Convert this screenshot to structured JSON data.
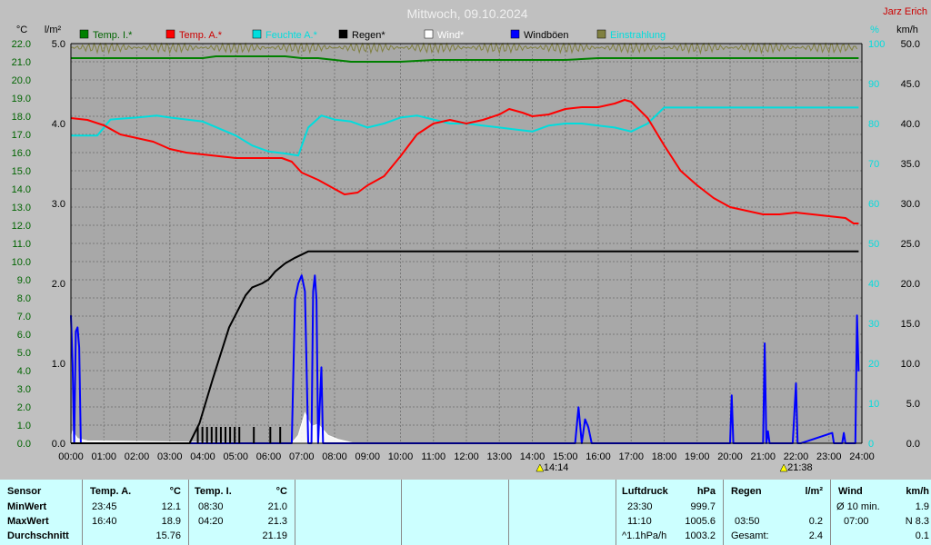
{
  "chart_data": {
    "type": "line",
    "title": "Mittwoch, 09.10.2024",
    "watermark": "Jarz Erich",
    "left_axis_1": {
      "unit": "°C",
      "ylim": [
        0,
        22
      ],
      "ticks": [
        "0.0",
        "1.0",
        "2.0",
        "3.0",
        "4.0",
        "5.0",
        "6.0",
        "7.0",
        "8.0",
        "9.0",
        "10.0",
        "11.0",
        "12.0",
        "13.0",
        "14.0",
        "15.0",
        "16.0",
        "17.0",
        "18.0",
        "19.0",
        "20.0",
        "21.0",
        "22.0"
      ]
    },
    "left_axis_2": {
      "unit": "l/m²",
      "ylim": [
        0,
        5
      ],
      "ticks": [
        "0.0",
        "1.0",
        "2.0",
        "3.0",
        "4.0",
        "5.0"
      ]
    },
    "right_axis_1": {
      "unit": "%",
      "ylim": [
        0,
        100
      ],
      "ticks": [
        "0",
        "10",
        "20",
        "30",
        "40",
        "50",
        "60",
        "70",
        "80",
        "90",
        "100"
      ]
    },
    "right_axis_2": {
      "unit": "km/h",
      "ylim": [
        0,
        50
      ],
      "ticks": [
        "0.0",
        "5.0",
        "10.0",
        "15.0",
        "20.0",
        "25.0",
        "30.0",
        "35.0",
        "40.0",
        "45.0",
        "50.0"
      ]
    },
    "x_ticks": [
      "00:00",
      "01:00",
      "02:00",
      "03:00",
      "04:00",
      "05:00",
      "06:00",
      "07:00",
      "08:00",
      "09:00",
      "10:00",
      "11:00",
      "12:00",
      "13:00",
      "14:00",
      "15:00",
      "16:00",
      "17:00",
      "18:00",
      "19:00",
      "20:00",
      "21:00",
      "22:00",
      "23:00",
      "24:00"
    ],
    "xlim": [
      0,
      24
    ],
    "grid": true,
    "legend": [
      "Temp. I.*",
      "Temp. A.*",
      "Feuchte A.*",
      "Regen*",
      "Wind*",
      "Windböen",
      "Einstrahlung"
    ],
    "markers": [
      {
        "time": 14.23,
        "label": "14:14"
      },
      {
        "time": 21.63,
        "label": "21:38"
      }
    ],
    "series": [
      {
        "name": "Temp. I.*",
        "axis": "left_axis_1",
        "color": "#008000",
        "x": [
          0,
          1,
          2,
          3,
          4,
          4.4,
          5,
          6,
          6.5,
          7,
          7.5,
          8,
          8.5,
          9,
          10,
          11,
          12,
          13,
          14,
          15,
          16,
          17,
          18,
          19,
          20,
          21,
          22,
          23,
          23.9
        ],
        "y": [
          21.2,
          21.2,
          21.2,
          21.2,
          21.2,
          21.3,
          21.3,
          21.3,
          21.3,
          21.2,
          21.2,
          21.1,
          21.0,
          21.0,
          21.0,
          21.1,
          21.1,
          21.1,
          21.1,
          21.1,
          21.2,
          21.2,
          21.2,
          21.2,
          21.2,
          21.2,
          21.2,
          21.2,
          21.2
        ]
      },
      {
        "name": "Temp. A.*",
        "axis": "left_axis_1",
        "color": "#ff0000",
        "x": [
          0,
          0.5,
          1,
          1.5,
          2,
          2.5,
          3,
          3.5,
          4,
          4.5,
          5,
          5.5,
          6,
          6.4,
          6.7,
          7,
          7.5,
          8,
          8.3,
          8.7,
          9,
          9.5,
          10,
          10.5,
          11,
          11.5,
          12,
          12.5,
          13,
          13.3,
          13.7,
          14,
          14.5,
          15,
          15.5,
          16,
          16.5,
          16.8,
          17,
          17.5,
          18,
          18.5,
          19,
          19.5,
          20,
          20.5,
          21,
          21.5,
          22,
          22.5,
          23,
          23.5,
          23.75,
          23.9
        ],
        "y": [
          17.9,
          17.8,
          17.5,
          17.0,
          16.8,
          16.6,
          16.2,
          16.0,
          15.9,
          15.8,
          15.7,
          15.7,
          15.7,
          15.7,
          15.5,
          14.9,
          14.5,
          14.0,
          13.7,
          13.8,
          14.2,
          14.7,
          15.8,
          17.0,
          17.6,
          17.8,
          17.6,
          17.8,
          18.1,
          18.4,
          18.2,
          18.0,
          18.1,
          18.4,
          18.5,
          18.5,
          18.7,
          18.9,
          18.8,
          17.9,
          16.4,
          15.0,
          14.2,
          13.5,
          13.0,
          12.8,
          12.6,
          12.6,
          12.7,
          12.6,
          12.5,
          12.4,
          12.1,
          12.1
        ]
      },
      {
        "name": "Feuchte A.*",
        "axis": "right_axis_1",
        "color": "#00dddd",
        "x": [
          0,
          0.8,
          1.2,
          2,
          2.6,
          3,
          4,
          5,
          5.5,
          6,
          6.5,
          6.9,
          7.2,
          7.6,
          8,
          8.5,
          9,
          9.5,
          10,
          10.5,
          11,
          11.5,
          12,
          12.5,
          13,
          13.5,
          14,
          14.5,
          15,
          15.5,
          16,
          16.5,
          17,
          17.5,
          18,
          19,
          20,
          21,
          22,
          23,
          23.9
        ],
        "y": [
          77,
          77,
          81,
          81.5,
          82,
          81.5,
          80.5,
          77,
          74.5,
          73,
          72.5,
          72,
          79,
          82,
          81,
          80.5,
          79,
          80,
          81.5,
          82,
          81,
          80,
          80,
          79.5,
          79,
          78.5,
          78,
          79.5,
          80,
          80,
          79.5,
          79,
          78,
          80,
          84,
          84,
          84,
          84,
          84,
          84,
          84
        ]
      },
      {
        "name": "Regen*",
        "axis": "left_axis_2",
        "color": "#000000",
        "x": [
          0,
          3.6,
          3.9,
          4.3,
          4.8,
          5.3,
          5.5,
          5.8,
          6.0,
          6.2,
          6.5,
          6.8,
          7.2,
          8,
          9,
          10,
          11,
          12,
          13,
          14,
          15,
          16,
          17,
          18,
          19,
          20,
          21,
          22,
          23,
          23.9
        ],
        "y": [
          0,
          0,
          0.25,
          0.8,
          1.45,
          1.85,
          1.95,
          2.0,
          2.05,
          2.15,
          2.25,
          2.32,
          2.4,
          2.4,
          2.4,
          2.4,
          2.4,
          2.4,
          2.4,
          2.4,
          2.4,
          2.4,
          2.4,
          2.4,
          2.4,
          2.4,
          2.4,
          2.4,
          2.4,
          2.4
        ]
      },
      {
        "name": "Wind*",
        "axis": "right_axis_2",
        "color": "#ffffff",
        "x": [
          0,
          0.05,
          0.2,
          0.5,
          6.7,
          6.9,
          7.1,
          7.3,
          7.5,
          7.8,
          8.1,
          8.4,
          8.6
        ],
        "y": [
          0.5,
          1.5,
          0.6,
          0.3,
          0,
          1.0,
          3.8,
          2.1,
          2.4,
          1.0,
          0.5,
          0.2,
          0
        ],
        "fill": true
      },
      {
        "name": "Windböen",
        "axis": "right_axis_2",
        "color": "#0000ff",
        "x": [
          0,
          0.05,
          0.1,
          0.15,
          0.2,
          0.25,
          0.3,
          0.35,
          0.4,
          0.45,
          0.5,
          6.7,
          6.8,
          6.9,
          7.0,
          7.1,
          7.2,
          7.3,
          7.35,
          7.4,
          7.45,
          7.5,
          7.6,
          7.65,
          7.7,
          7.8,
          7.9,
          15.3,
          15.4,
          15.5,
          15.6,
          15.7,
          15.8,
          15.9,
          20.0,
          20.05,
          20.1,
          21.0,
          21.05,
          21.1,
          21.15,
          21.2,
          21.3,
          21.9,
          22.0,
          22.05,
          22.15,
          23.1,
          23.15,
          23.2,
          23.4,
          23.45,
          23.5,
          23.8,
          23.85,
          23.9
        ],
        "y": [
          16,
          10,
          0,
          14,
          14.5,
          12,
          0,
          0,
          0,
          0,
          0,
          0,
          18,
          20,
          21,
          19,
          0,
          0,
          19,
          21,
          18,
          0,
          9.5,
          0,
          0,
          0,
          0,
          0,
          4.5,
          0,
          3,
          2,
          0,
          0,
          0,
          6,
          0,
          0,
          12.5,
          0,
          1.5,
          0,
          0,
          0,
          7.5,
          0,
          0,
          1.3,
          0,
          0,
          0,
          1.3,
          0,
          0,
          16,
          9
        ]
      },
      {
        "name": "Einstrahlung",
        "axis": "right_axis_1",
        "color": "#808040",
        "noise_base": 99,
        "noise_amp": 1.2
      }
    ]
  },
  "stats": {
    "sensor_header": "Sensor",
    "row_labels": [
      "MinWert",
      "MaxWert",
      "Durchschnitt"
    ],
    "temp_a": {
      "header": "Temp. A.",
      "unit": "°C",
      "min_time": "23:45",
      "min_val": "12.1",
      "max_time": "16:40",
      "max_val": "18.9",
      "avg": "15.76"
    },
    "temp_i": {
      "header": "Temp. I.",
      "unit": "°C",
      "min_time": "08:30",
      "min_val": "21.0",
      "max_time": "04:20",
      "max_val": "21.3",
      "avg": "21.19"
    },
    "luftdruck": {
      "header": "Luftdruck",
      "unit": "hPa",
      "min_time": "23:30",
      "min_val": "999.7",
      "max_time": "11:10",
      "max_val": "1005.6",
      "trend_label": "^1.1hPa/h",
      "avg": "1003.2"
    },
    "regen": {
      "header": "Regen",
      "unit": "l/m²",
      "max_time": "03:50",
      "max_val": "0.2",
      "total_label": "Gesamt:",
      "total_val": "2.4"
    },
    "wind": {
      "header": "Wind",
      "unit": "km/h",
      "avg10_label": "Ø 10 min.",
      "avg10_val": "1.9",
      "max_time": "07:00",
      "max_val": "N 8.3",
      "avg": "0.1"
    }
  }
}
